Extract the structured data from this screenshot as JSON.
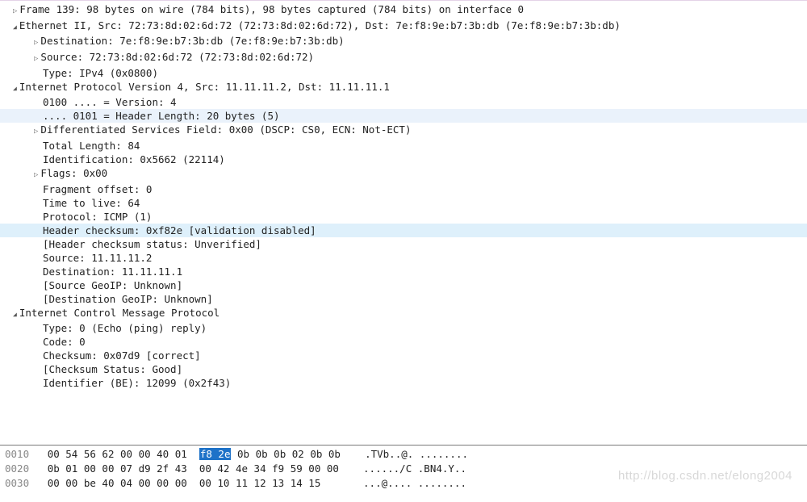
{
  "tree": {
    "frame": "Frame 139: 98 bytes on wire (784 bits), 98 bytes captured (784 bits) on interface 0",
    "eth": {
      "summary": "Ethernet II, Src: 72:73:8d:02:6d:72 (72:73:8d:02:6d:72), Dst: 7e:f8:9e:b7:3b:db (7e:f8:9e:b7:3b:db)",
      "dst": "Destination: 7e:f8:9e:b7:3b:db (7e:f8:9e:b7:3b:db)",
      "src": "Source: 72:73:8d:02:6d:72 (72:73:8d:02:6d:72)",
      "type": "Type: IPv4 (0x0800)"
    },
    "ip": {
      "summary": "Internet Protocol Version 4, Src: 11.11.11.2, Dst: 11.11.11.1",
      "version": "0100 .... = Version: 4",
      "hlen": ".... 0101 = Header Length: 20 bytes (5)",
      "dsf": "Differentiated Services Field: 0x00 (DSCP: CS0, ECN: Not-ECT)",
      "totlen": "Total Length: 84",
      "ident": "Identification: 0x5662 (22114)",
      "flags": "Flags: 0x00",
      "fragoff": "Fragment offset: 0",
      "ttl": "Time to live: 64",
      "proto": "Protocol: ICMP (1)",
      "cksum": "Header checksum: 0xf82e [validation disabled]",
      "cksumstat": "[Header checksum status: Unverified]",
      "src": "Source: 11.11.11.2",
      "dst": "Destination: 11.11.11.1",
      "geosrc": "[Source GeoIP: Unknown]",
      "geodst": "[Destination GeoIP: Unknown]"
    },
    "icmp": {
      "summary": "Internet Control Message Protocol",
      "type": "Type: 0 (Echo (ping) reply)",
      "code": "Code: 0",
      "cksum": "Checksum: 0x07d9 [correct]",
      "cksumstat": "[Checksum Status: Good]",
      "idbe": "Identifier (BE): 12099 (0x2f43)"
    }
  },
  "hex": {
    "rows": [
      {
        "off": "0010",
        "b1": "00 54 56 62 00 00 40 01",
        "sel": "f8 2e",
        "b2": "0b 0b 0b 02 0b 0b",
        "ascii": ".TVb..@. ........"
      },
      {
        "off": "0020",
        "bytes": "0b 01 00 00 07 d9 2f 43  00 42 4e 34 f9 59 00 00",
        "ascii": "....../C .BN4.Y.."
      },
      {
        "off": "0030",
        "bytes": "00 00 be 40 04 00 00 00  00 10 11 12 13 14 15   ",
        "ascii": "...@.... ........"
      }
    ]
  },
  "watermark": "http://blog.csdn.net/elong2004"
}
